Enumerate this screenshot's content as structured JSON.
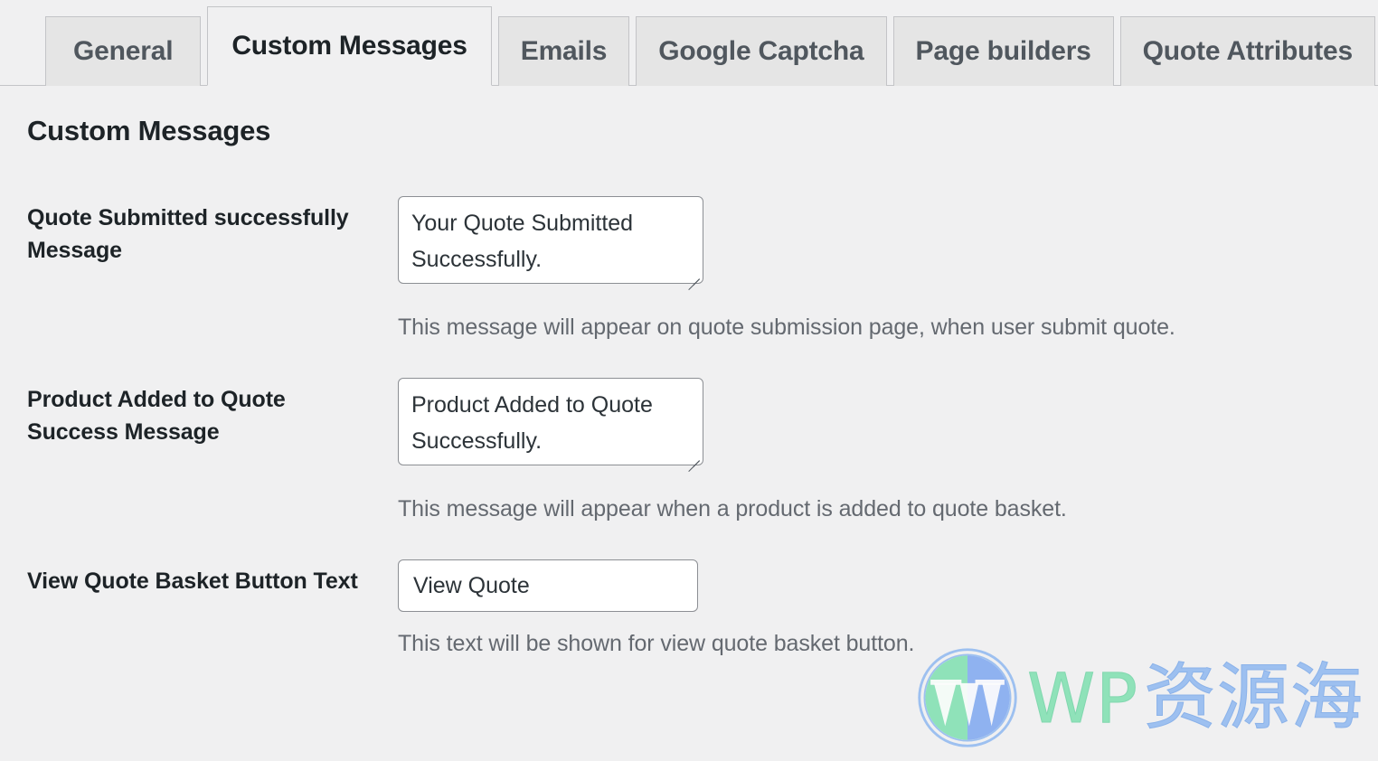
{
  "tabs": [
    {
      "label": "General",
      "active": false
    },
    {
      "label": "Custom Messages",
      "active": true
    },
    {
      "label": "Emails",
      "active": false
    },
    {
      "label": "Google Captcha",
      "active": false
    },
    {
      "label": "Page builders",
      "active": false
    },
    {
      "label": "Quote Attributes",
      "active": false
    }
  ],
  "page": {
    "heading": "Custom Messages"
  },
  "fields": [
    {
      "label": "Quote Submitted successfully Message",
      "type": "textarea",
      "value": "Your Quote Submitted Successfully.",
      "description": "This message will appear on quote submission page, when user submit quote."
    },
    {
      "label": "Product Added to Quote Success Message",
      "type": "textarea",
      "value": "Product Added to Quote Successfully.",
      "description": "This message will appear when a product is added to quote basket."
    },
    {
      "label": "View Quote Basket Button Text",
      "type": "text",
      "value": "View Quote",
      "description": "This text will be shown for view quote basket button."
    }
  ],
  "watermark": {
    "brand_latin": "WP",
    "brand_cjk": "资源海",
    "logo_icon": "wordpress-logo-icon",
    "color_latin": "#7fe0b0",
    "color_cjk": "#8fb8f0"
  },
  "colors": {
    "page_background": "#f0f0f1",
    "tab_inactive_background": "#e5e5e5",
    "tab_border": "#c3c4c7",
    "text_primary": "#1d2327",
    "text_muted": "#646970",
    "field_border": "#8c8f94"
  }
}
